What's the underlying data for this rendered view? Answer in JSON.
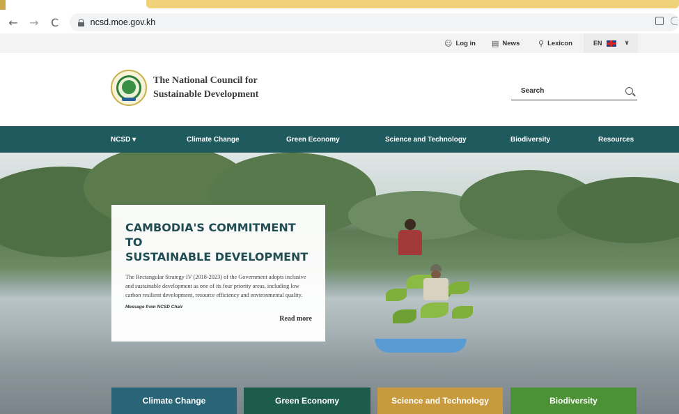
{
  "browser": {
    "url": "ncsd.moe.gov.kh",
    "back_glyph": "←",
    "forward_glyph": "→",
    "reload_glyph": "C"
  },
  "topbar": {
    "login": "Log in",
    "news": "News",
    "lexicon": "Lexicon",
    "language": "EN"
  },
  "header": {
    "org_line1": "The National Council for",
    "org_line2": "Sustainable Development",
    "search_placeholder": "Search"
  },
  "nav": {
    "items": [
      {
        "label": "NCSD ▾"
      },
      {
        "label": "Climate Change"
      },
      {
        "label": "Green Economy"
      },
      {
        "label": "Science and Technology"
      },
      {
        "label": "Biodiversity"
      },
      {
        "label": "Resources"
      }
    ]
  },
  "hero": {
    "title_line1": "CAMBODIA'S COMMITMENT TO",
    "title_line2": "SUSTAINABLE DEVELOPMENT",
    "body": "The Rectangular Strategy IV (2018-2023) of the Government adopts inclusive and sustainable development as one of its four priority areas, including low carbon resilient development, resource efficiency and environmental quality.",
    "signature": "Message from NCSD Chair",
    "read_more": "Read more"
  },
  "tiles": [
    {
      "label": "Climate Change",
      "color": "#2a6477"
    },
    {
      "label": "Green Economy",
      "color": "#1d5c4b"
    },
    {
      "label": "Science and Technology",
      "color": "#c79a3d"
    },
    {
      "label": "Biodiversity",
      "color": "#4c9136"
    }
  ],
  "colors": {
    "nav_bg": "#1f5a5f",
    "topbar_bg": "#f3f3f3",
    "title_color": "#1f4d52"
  }
}
